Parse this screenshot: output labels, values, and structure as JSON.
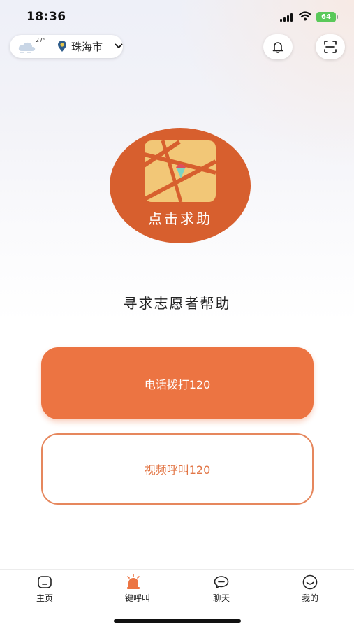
{
  "status_bar": {
    "time": "18:36",
    "battery": "64"
  },
  "header": {
    "temperature": "27°",
    "city": "珠海市",
    "weather_icon": "cloud-icon",
    "bell_icon": "bell-icon",
    "scan_icon": "scan-icon"
  },
  "main": {
    "help_button_label": "点击求助",
    "volunteer_text": "寻求志愿者帮助",
    "call_button_label": "电话拨打120",
    "video_button_label": "视频呼叫120"
  },
  "tabs": [
    {
      "label": "主页",
      "icon": "home-icon"
    },
    {
      "label": "一键呼叫",
      "icon": "alarm-icon",
      "active": true
    },
    {
      "label": "聊天",
      "icon": "chat-icon"
    },
    {
      "label": "我的",
      "icon": "profile-icon"
    }
  ],
  "colors": {
    "accent": "#ec7442",
    "help_circle": "#d75f2e",
    "map_tile": "#f2c777",
    "battery": "#5ac95a"
  }
}
